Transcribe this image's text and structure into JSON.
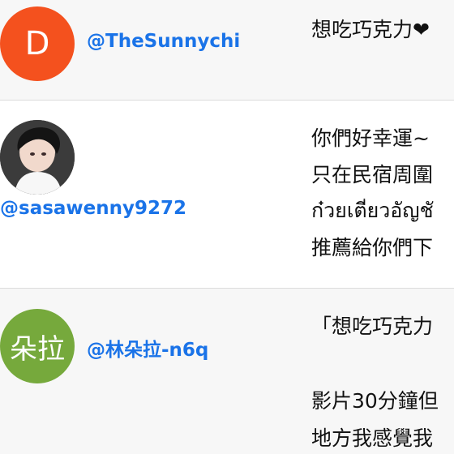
{
  "comments": [
    {
      "avatar_letter": "D",
      "avatar_color": "#f4511e",
      "handle": "@TheSunnychi",
      "text": "想吃巧克力❤"
    },
    {
      "avatar_kind": "photo",
      "handle": "@sasawenny9272",
      "lines": [
        "你們好幸運~",
        "只在民宿周圍",
        "ก๋วยเตี๋ยวอัญชั",
        "推薦給你們下"
      ]
    },
    {
      "avatar_text": "朵拉",
      "avatar_color": "#76a93c",
      "handle": "@林朵拉-n6q",
      "lines": [
        "「想吃巧克力",
        "",
        "影片30分鐘但",
        "地方我感覺我"
      ]
    }
  ]
}
